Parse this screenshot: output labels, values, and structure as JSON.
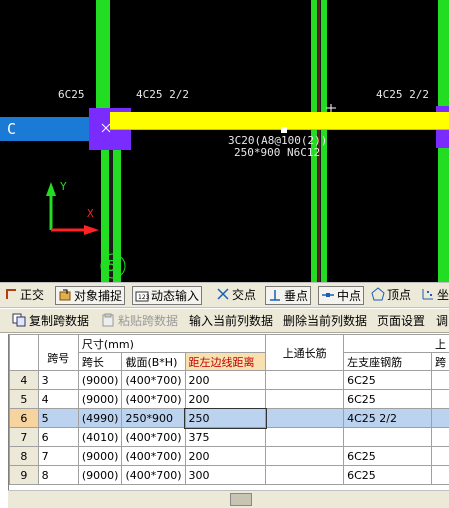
{
  "cad": {
    "labels": {
      "left_rebar": "6C25",
      "mid_rebar": "4C25 2/2",
      "right_rebar": "4C25 2/2",
      "beam_line1": "3C20(A8@100(2))",
      "beam_line2": "250*900 N6C12",
      "axis_c": "C",
      "axis_5": "5",
      "axis_x": "X",
      "axis_y": "Y"
    },
    "colors": {
      "background": "#000000",
      "column": "#22dd22",
      "beam": "#ffff00",
      "support": "#7a2cff",
      "axis_bubble": "#1a7ad6"
    }
  },
  "snapbar": {
    "items": [
      {
        "label": "正交",
        "icon": "ortho-icon"
      },
      {
        "label": "对象捕捉",
        "icon": "object-snap-icon"
      },
      {
        "label": "动态输入",
        "icon": "dynamic-input-icon"
      },
      {
        "label": "交点",
        "icon": "intersection-icon"
      },
      {
        "label": "垂点",
        "icon": "perpendicular-icon"
      },
      {
        "label": "中点",
        "icon": "midpoint-icon"
      },
      {
        "label": "顶点",
        "icon": "vertex-icon"
      },
      {
        "label": "坐",
        "icon": "coordinate-icon"
      }
    ]
  },
  "actionbar": {
    "copy": "复制跨数据",
    "paste": "粘贴跨数据",
    "input_col": "输入当前列数据",
    "delete_col": "删除当前列数据",
    "page_setup": "页面设置",
    "adjust": "调"
  },
  "grid": {
    "header": {
      "span_no": "跨号",
      "size_group": "尺寸(mm)",
      "span_len": "跨长",
      "section": "截面(B*H)",
      "edge_dist": "距左边线距离",
      "top_through": "上通长筋",
      "top_group": "上",
      "left_support": "左支座钢筋",
      "span_mid": "跨"
    },
    "rows": [
      {
        "num": "4",
        "span": "3",
        "len": "(9000)",
        "sec": "(400*700)",
        "dist": "200",
        "top": "",
        "left": "6C25"
      },
      {
        "num": "5",
        "span": "4",
        "len": "(9000)",
        "sec": "(400*700)",
        "dist": "200",
        "top": "",
        "left": "6C25"
      },
      {
        "num": "6",
        "span": "5",
        "len": "(4990)",
        "sec": "250*900",
        "dist": "250",
        "top": "",
        "left": "4C25 2/2"
      },
      {
        "num": "7",
        "span": "6",
        "len": "(4010)",
        "sec": "(400*700)",
        "dist": "375",
        "top": "",
        "left": ""
      },
      {
        "num": "8",
        "span": "7",
        "len": "(9000)",
        "sec": "(400*700)",
        "dist": "200",
        "top": "",
        "left": "6C25"
      },
      {
        "num": "9",
        "span": "8",
        "len": "(9000)",
        "sec": "(400*700)",
        "dist": "300",
        "top": "",
        "left": "6C25"
      }
    ],
    "selected_row": 2
  }
}
